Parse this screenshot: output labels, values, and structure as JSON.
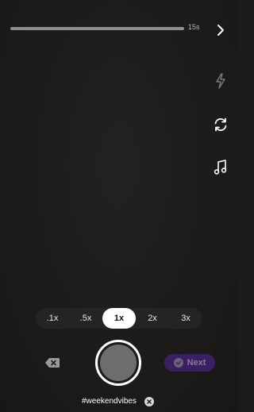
{
  "recording": {
    "progress": 0.0,
    "max_duration_label": "15s"
  },
  "top_controls": {
    "next_icon": "chevron-right-icon",
    "flash_icon": "flash-icon",
    "flip_icon": "flip-camera-icon",
    "music_icon": "music-icon"
  },
  "speed": {
    "options": [
      ".1x",
      ".5x",
      "1x",
      "2x",
      "3x"
    ],
    "selected": "1x"
  },
  "bottom": {
    "delete_icon": "backspace-icon",
    "next_label": "Next",
    "next_enabled": false
  },
  "hashtag": {
    "text": "#weekendvibes"
  },
  "colors": {
    "background": "#1d1b1a",
    "accent_disabled": "#3a1f63",
    "shutter": "#6f6d6c"
  }
}
